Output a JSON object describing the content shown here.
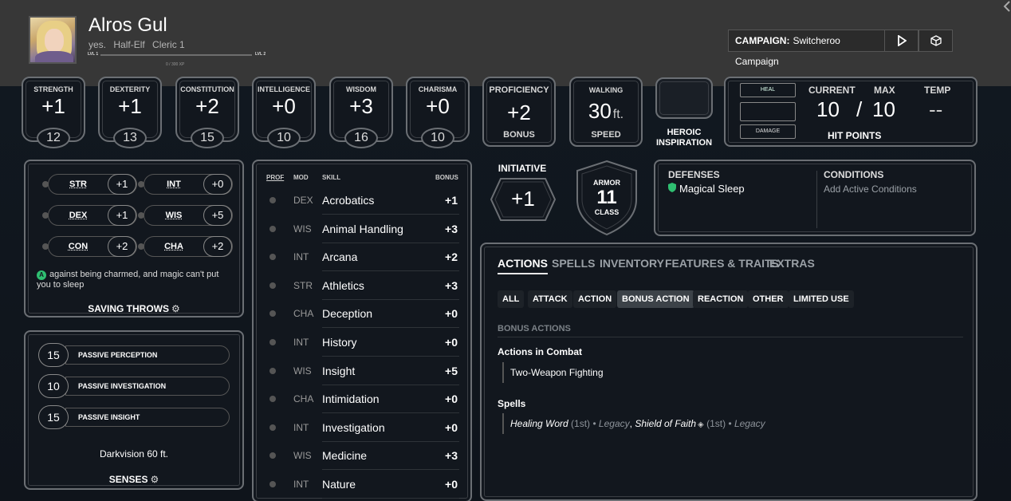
{
  "header": {
    "name": "Alros Gul",
    "sub": [
      "yes.",
      "Half-Elf",
      "Cleric 1"
    ],
    "lvl_left": "LVL 1",
    "lvl_right": "LVL 2",
    "xp": "0 / 300 XP",
    "campaign_label": "CAMPAIGN:",
    "campaign_name": "Switcheroo Campaign"
  },
  "abilities": [
    {
      "label": "STRENGTH",
      "mod": "+1",
      "score": "12"
    },
    {
      "label": "DEXTERITY",
      "mod": "+1",
      "score": "13"
    },
    {
      "label": "CONSTITUTION",
      "mod": "+2",
      "score": "15"
    },
    {
      "label": "INTELLIGENCE",
      "mod": "+0",
      "score": "10"
    },
    {
      "label": "WISDOM",
      "mod": "+3",
      "score": "16"
    },
    {
      "label": "CHARISMA",
      "mod": "+0",
      "score": "10"
    }
  ],
  "proficiency": {
    "title": "PROFICIENCY",
    "value": "+2",
    "sub": "BONUS"
  },
  "walking": {
    "title": "WALKING",
    "value": "30",
    "unit": "ft.",
    "sub": "SPEED"
  },
  "heroic": {
    "line1": "HEROIC",
    "line2": "INSPIRATION"
  },
  "hp": {
    "heal": "HEAL",
    "damage": "DAMAGE",
    "current_label": "CURRENT",
    "max_label": "MAX",
    "temp_label": "TEMP",
    "current": "10",
    "sep": "/",
    "max": "10",
    "temp": "--",
    "title": "HIT POINTS"
  },
  "saves": {
    "items": [
      {
        "ab": "STR",
        "mod": "+1"
      },
      {
        "ab": "INT",
        "mod": "+0"
      },
      {
        "ab": "DEX",
        "mod": "+1"
      },
      {
        "ab": "WIS",
        "mod": "+5"
      },
      {
        "ab": "CON",
        "mod": "+2"
      },
      {
        "ab": "CHA",
        "mod": "+2"
      }
    ],
    "adv_icon": "A",
    "note": "against being charmed, and magic can't put you to sleep",
    "title": "SAVING THROWS"
  },
  "senses": {
    "items": [
      {
        "value": "15",
        "label": "PASSIVE PERCEPTION"
      },
      {
        "value": "10",
        "label": "PASSIVE INVESTIGATION"
      },
      {
        "value": "15",
        "label": "PASSIVE INSIGHT"
      }
    ],
    "darkvision": "Darkvision 60 ft.",
    "title": "SENSES"
  },
  "skills": {
    "head_prof": "PROF",
    "head_mod": "MOD",
    "head_skill": "SKILL",
    "head_bonus": "BONUS",
    "items": [
      {
        "mod": "DEX",
        "name": "Acrobatics",
        "bonus": "+1"
      },
      {
        "mod": "WIS",
        "name": "Animal Handling",
        "bonus": "+3"
      },
      {
        "mod": "INT",
        "name": "Arcana",
        "bonus": "+2"
      },
      {
        "mod": "STR",
        "name": "Athletics",
        "bonus": "+3"
      },
      {
        "mod": "CHA",
        "name": "Deception",
        "bonus": "+0"
      },
      {
        "mod": "INT",
        "name": "History",
        "bonus": "+0"
      },
      {
        "mod": "WIS",
        "name": "Insight",
        "bonus": "+5"
      },
      {
        "mod": "CHA",
        "name": "Intimidation",
        "bonus": "+0"
      },
      {
        "mod": "INT",
        "name": "Investigation",
        "bonus": "+0"
      },
      {
        "mod": "WIS",
        "name": "Medicine",
        "bonus": "+3"
      },
      {
        "mod": "INT",
        "name": "Nature",
        "bonus": "+0"
      }
    ]
  },
  "initiative": {
    "label": "INITIATIVE",
    "value": "+1"
  },
  "armor": {
    "top": "ARMOR",
    "value": "11",
    "bottom": "CLASS"
  },
  "defenses": {
    "title": "DEFENSES",
    "item": "Magical Sleep",
    "conditions_title": "CONDITIONS",
    "conditions_link": "Add Active Conditions"
  },
  "actions": {
    "tabs": [
      "ACTIONS",
      "SPELLS",
      "INVENTORY",
      "FEATURES & TRAITS",
      "EXTRAS"
    ],
    "filters": [
      "ALL",
      "ATTACK",
      "ACTION",
      "BONUS ACTION",
      "REACTION",
      "OTHER",
      "LIMITED USE"
    ],
    "section": "BONUS ACTIONS",
    "combat_title": "Actions in Combat",
    "combat_item": "Two-Weapon Fighting",
    "spells_title": "Spells",
    "spell1": "Healing Word",
    "spell1_lvl": "(1st)",
    "spell1_tag": "• Legacy",
    "spell2": "Shield of Faith",
    "spell2_lvl": "(1st)",
    "spell2_tag": "• Legacy"
  },
  "colors": {
    "accent_green": "#2fbf71",
    "header_bg": "#373737",
    "page_bg": "#10151c"
  }
}
